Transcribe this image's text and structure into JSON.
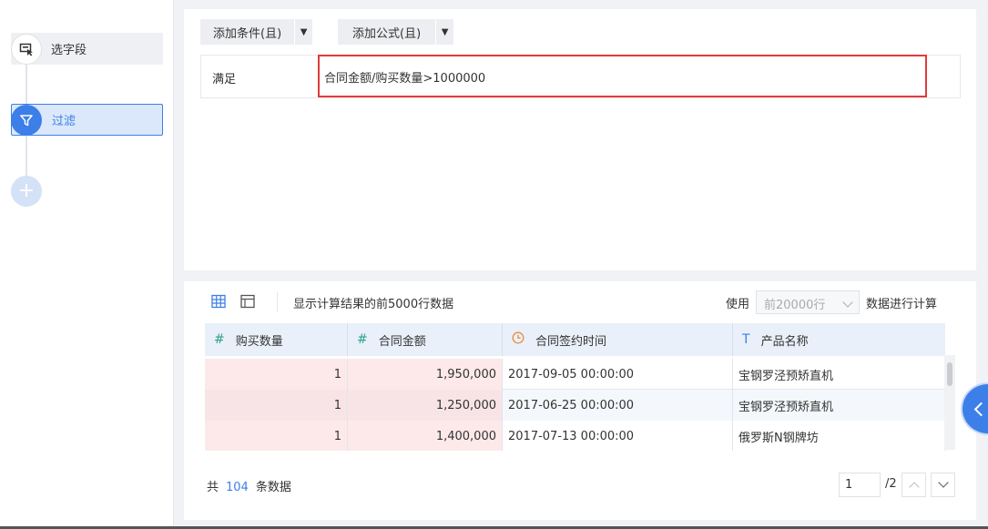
{
  "sidebar": {
    "steps": [
      {
        "label": "选字段",
        "icon": "select-field-icon"
      },
      {
        "label": "过滤",
        "icon": "filter-icon",
        "active": true
      }
    ],
    "add_label": "+"
  },
  "filter_panel": {
    "add_condition_label": "添加条件(且)",
    "add_formula_label": "添加公式(且)",
    "condition": {
      "label": "满足",
      "formula": "合同金额/购买数量>1000000"
    }
  },
  "preview": {
    "toolbar": {
      "grid_view_icon": "table-grid-icon",
      "layout_view_icon": "layout-panel-icon",
      "info_text": "显示计算结果的前5000行数据",
      "use_label": "使用",
      "use_select_value": "前20000行",
      "use_suffix": "数据进行计算"
    },
    "table": {
      "columns": [
        {
          "icon": "#",
          "label": "购买数量",
          "type": "number"
        },
        {
          "icon": "#",
          "label": "合同金额",
          "type": "number"
        },
        {
          "icon": "clock-icon",
          "label": "合同签约时间",
          "type": "date"
        },
        {
          "icon": "T",
          "label": "产品名称",
          "type": "text"
        }
      ],
      "rows": [
        [
          "1",
          "1,950,000",
          "2017-09-05 00:00:00",
          "宝钢罗泾预矫直机"
        ],
        [
          "1",
          "1,250,000",
          "2017-06-25 00:00:00",
          "宝钢罗泾预矫直机"
        ],
        [
          "1",
          "1,400,000",
          "2017-07-13 00:00:00",
          "俄罗斯N钢牌坊"
        ]
      ]
    },
    "footer": {
      "total_prefix": "共",
      "total_count": "104",
      "total_suffix": "条数据",
      "page_current": "1",
      "page_total": "/2"
    }
  },
  "colors": {
    "accent": "#3d7fe8",
    "highlight_border": "#e23b3b",
    "number_cell_bg": "#fde9ea",
    "header_bg": "#e9f0fa"
  }
}
